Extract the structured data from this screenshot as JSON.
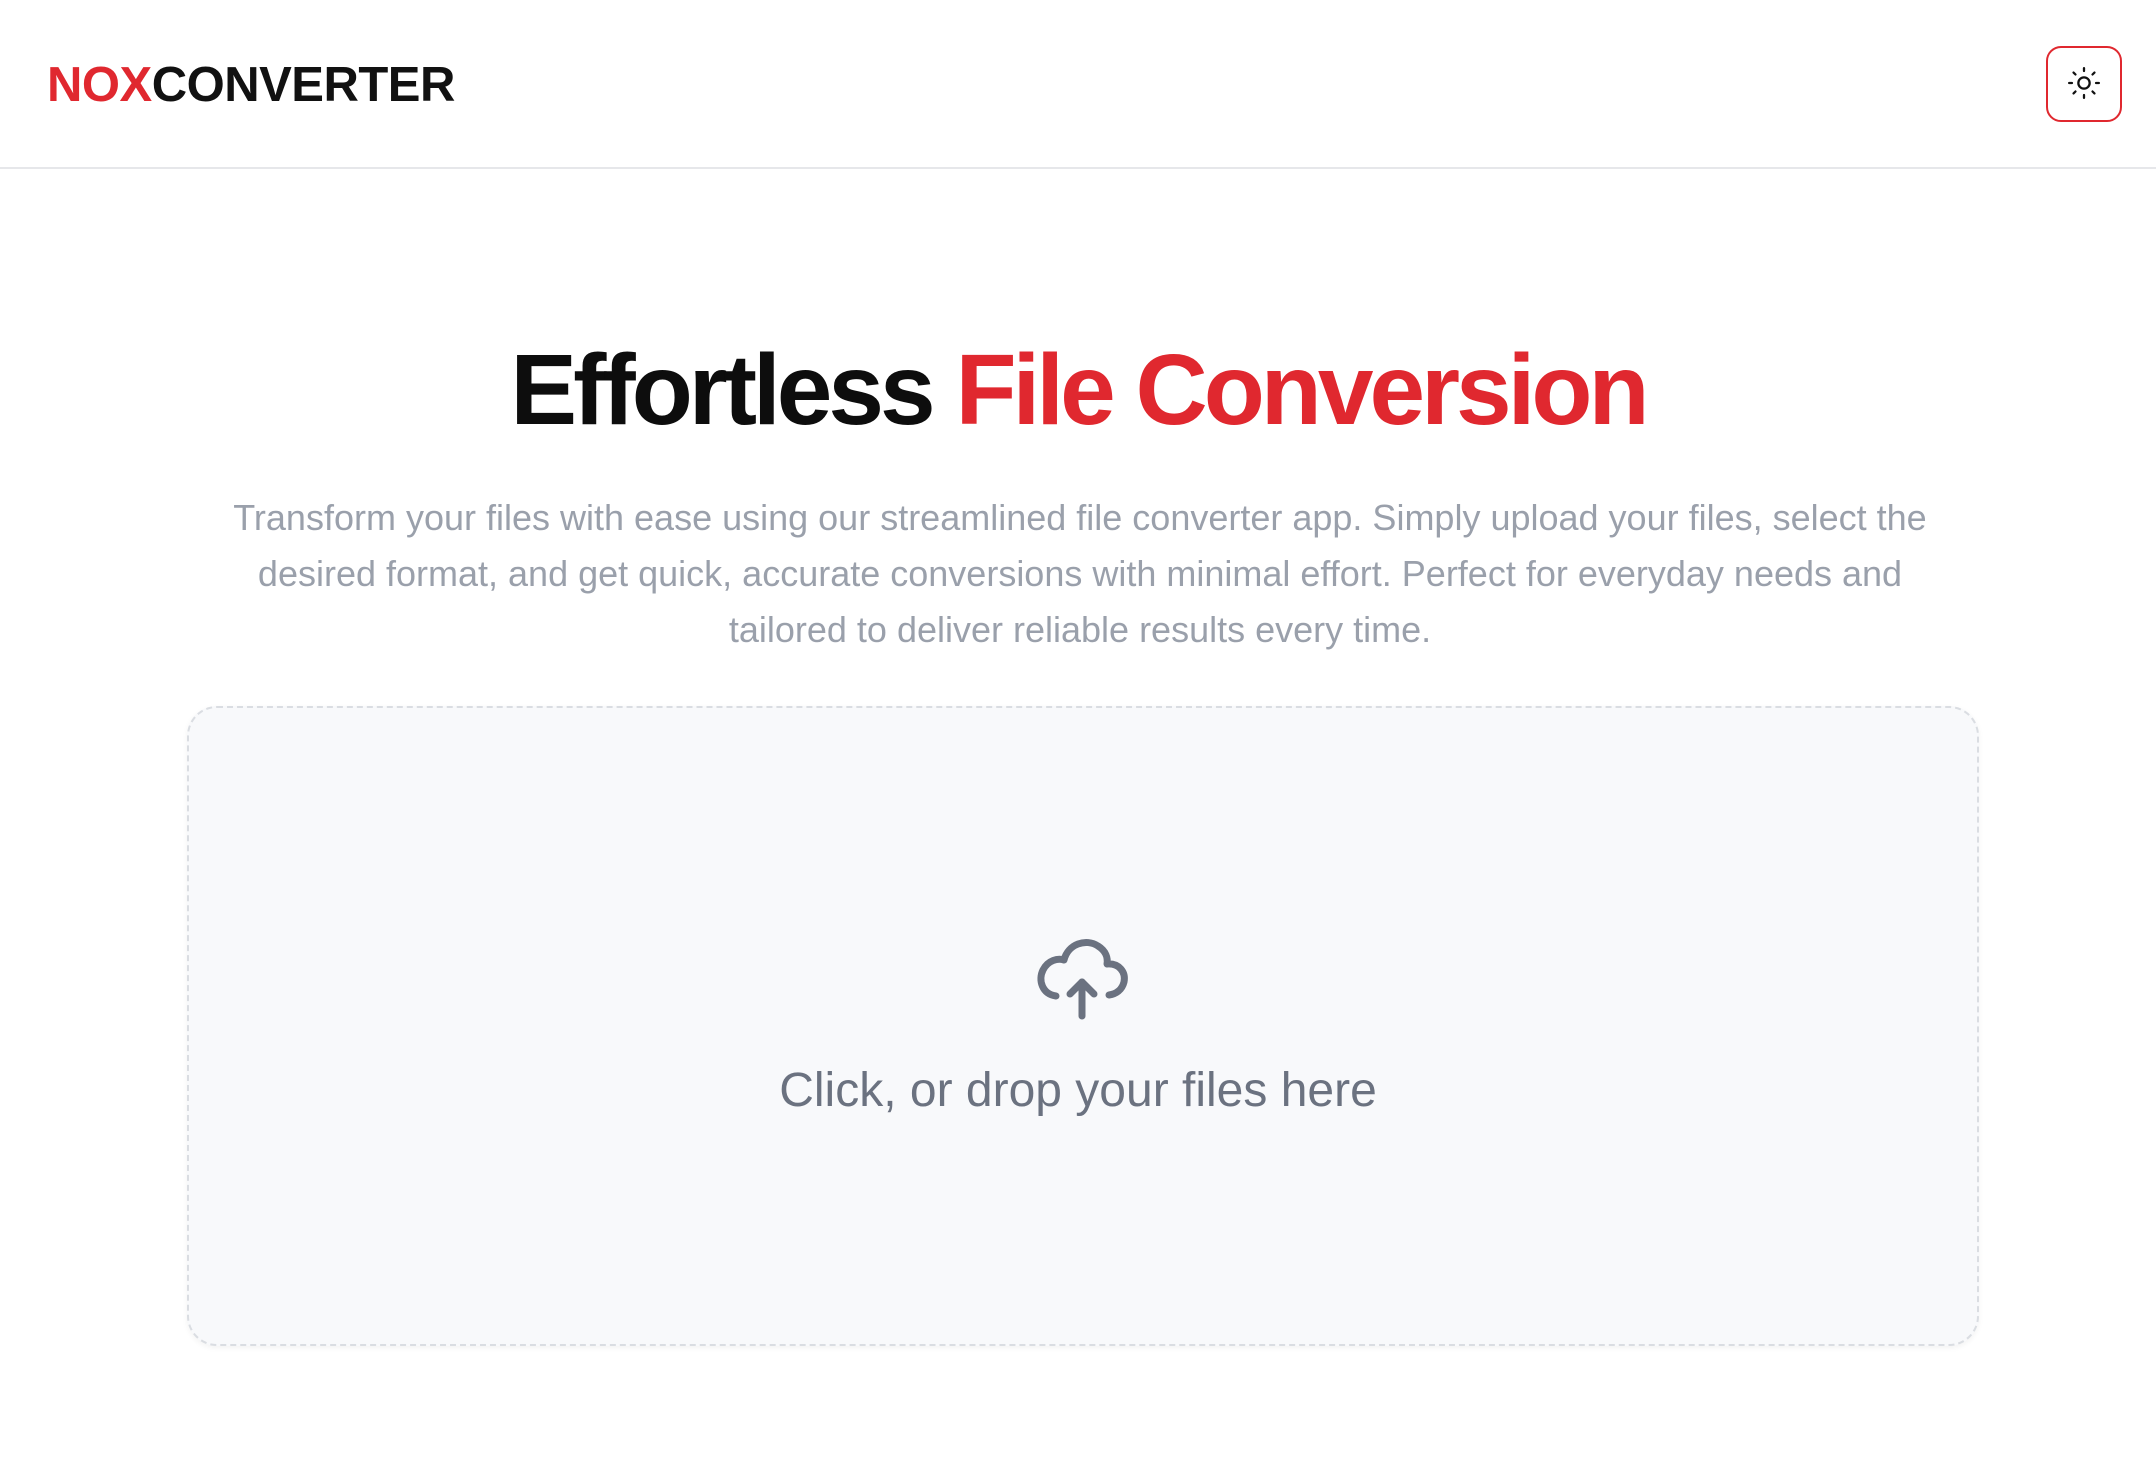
{
  "header": {
    "logo_accent": "NOX",
    "logo_rest": "CONVERTER",
    "theme_toggle_icon": "sun-icon"
  },
  "hero": {
    "title_part1": "Effortless",
    "title_part2": "File Conversion",
    "description": "Transform your files with ease using our streamlined file converter app. Simply upload your files, select the desired format, and get quick, accurate conversions with minimal effort. Perfect for everyday needs and tailored to deliver reliable results every time."
  },
  "dropzone": {
    "icon": "cloud-upload-icon",
    "label": "Click, or drop your files here"
  },
  "colors": {
    "accent": "#e0282f",
    "text_dark": "#0d0d0d",
    "text_muted": "#9aa0ab",
    "dropzone_bg": "#f8f9fb"
  }
}
